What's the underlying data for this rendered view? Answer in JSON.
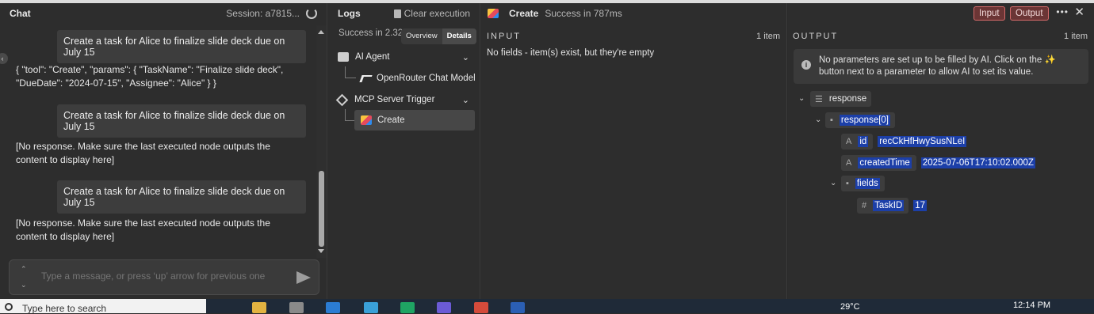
{
  "chat": {
    "title": "Chat",
    "session": "Session: a7815...",
    "messages": [
      {
        "role": "user",
        "text": "Create a task for Alice to finalize slide deck due on July 15"
      },
      {
        "role": "bot",
        "text": "{ \"tool\": \"Create\", \"params\": { \"TaskName\": \"Finalize slide deck\", \"DueDate\": \"2024-07-15\", \"Assignee\": \"Alice\" } }"
      },
      {
        "role": "user",
        "text": "Create a task for Alice to finalize slide deck due on July 15"
      },
      {
        "role": "bot",
        "text": "[No response. Make sure the last executed node outputs the content to display here]"
      },
      {
        "role": "user",
        "text": "Create a task for Alice to finalize slide deck due on July 15"
      },
      {
        "role": "bot",
        "text": "[No response. Make sure the last executed node outputs the content to display here]"
      }
    ],
    "composer_placeholder": "Type a message, or press ‘up’ arrow for previous one"
  },
  "logs": {
    "title": "Logs",
    "clear_label": "Clear execution",
    "status": "Success in 2.32",
    "tabs": [
      "Overview",
      "Details"
    ],
    "active_tab": "Details",
    "nodes": [
      {
        "label": "AI Agent",
        "icon": "robot-icon",
        "child": "OpenRouter Chat Model",
        "child_icon": "openrouter-icon"
      },
      {
        "label": "MCP Server Trigger",
        "icon": "mcp-icon",
        "child": "Create",
        "child_icon": "airtable-icon"
      }
    ]
  },
  "node_header": {
    "name": "Create",
    "status": "Success in 787ms",
    "input_button": "Input",
    "output_button": "Output"
  },
  "input": {
    "label": "INPUT",
    "count": "1 item",
    "message": "No fields - item(s) exist, but they're empty"
  },
  "output": {
    "label": "OUTPUT",
    "count": "1 item",
    "notice": "No parameters are set up to be filled by AI. Click on the ✨ button next to a parameter to allow AI to set its value.",
    "tree": {
      "root": "response",
      "item": "response[0]",
      "id_key": "id",
      "id_value": "recCkHfHwySusNLeI",
      "created_key": "createdTime",
      "created_value": "2025-07-06T17:10:02.000Z",
      "fields_key": "fields",
      "taskid_key": "TaskID",
      "taskid_value": "17"
    }
  },
  "taskbar": {
    "search_placeholder": "Type here to search",
    "weather": "29°C",
    "time": "12:14 PM"
  },
  "colors": {
    "highlight": "#1c3fa8",
    "toggle_border": "#d46a6a",
    "panel_bg": "#2d2d2d"
  }
}
